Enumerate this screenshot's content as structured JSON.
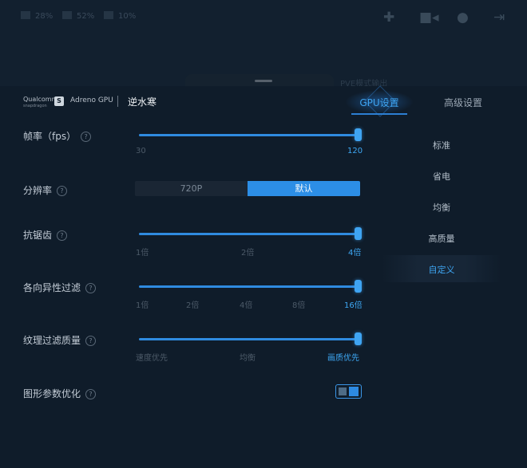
{
  "status_bar": {
    "stat1": {
      "icon": "bolt-icon",
      "value": "28%"
    },
    "stat2": {
      "icon": "cpu-icon",
      "value": "52%"
    },
    "stat3": {
      "icon": "gpu-icon",
      "value": "10%"
    },
    "faint_text": "PVE模式输出"
  },
  "header": {
    "brand_text": "Qualcomm",
    "brand_sub": "snapdragon",
    "brand_s": "S",
    "gpu_name": "Adreno GPU",
    "game_name": "逆水寒"
  },
  "tabs": {
    "gpu": "GPU设置",
    "advanced": "高级设置",
    "active": "gpu"
  },
  "settings": {
    "fps": {
      "label": "帧率（fps）",
      "min": "30",
      "max": "120",
      "value": 120
    },
    "resolution": {
      "label": "分辨率",
      "options": [
        "720P",
        "默认"
      ],
      "selected": "默认"
    },
    "antialias": {
      "label": "抗锯齿",
      "ticks": [
        "1倍",
        "2倍",
        "4倍"
      ],
      "selected": "4倍"
    },
    "anisotropic": {
      "label": "各向异性过滤",
      "ticks": [
        "1倍",
        "2倍",
        "4倍",
        "8倍",
        "16倍"
      ],
      "selected": "16倍"
    },
    "texture_quality": {
      "label": "纹理过滤质量",
      "ticks": [
        "速度优先",
        "均衡",
        "画质优先"
      ],
      "selected": "画质优先"
    },
    "graphics_opt": {
      "label": "图形参数优化",
      "enabled": true
    }
  },
  "modes": {
    "items": [
      "标准",
      "省电",
      "均衡",
      "高质量",
      "自定义"
    ],
    "selected": "自定义"
  },
  "help_symbol": "?",
  "colors": {
    "accent": "#3ea4f0",
    "background": "#0f1c2a"
  }
}
